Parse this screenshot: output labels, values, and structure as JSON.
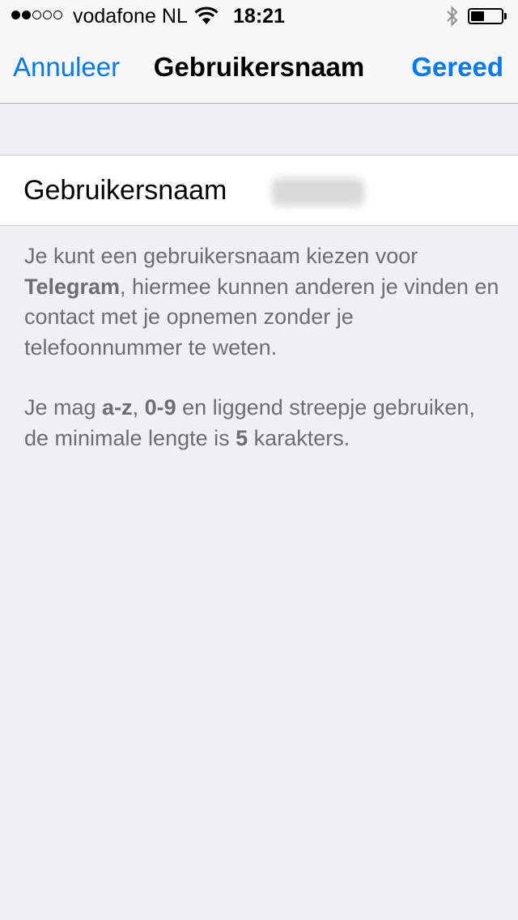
{
  "status_bar": {
    "signal_strength": "2 of 5",
    "carrier": "vodafone NL",
    "time": "18:21",
    "battery_level": 0.45,
    "icons": [
      "signal-dots-icon",
      "wifi-icon",
      "bluetooth-icon",
      "battery-icon"
    ]
  },
  "nav": {
    "cancel_label": "Annuleer",
    "title": "Gebruikersnaam",
    "done_label": "Gereed"
  },
  "field": {
    "label": "Gebruikersnaam",
    "value": "blurred"
  },
  "footer": {
    "p1_a": "Je kunt een gebruikersnaam kiezen voor ",
    "p1_b": "Telegram",
    "p1_c": ", hiermee kunnen anderen je vinden en contact met je opnemen zonder je telefoonnummer te weten.",
    "p2_a": "Je mag ",
    "p2_b": "a-z",
    "p2_c": ", ",
    "p2_d": "0-9",
    "p2_e": " en liggend streepje gebruiken, de minimale lengte is ",
    "p2_f": "5",
    "p2_g": " karakters."
  },
  "colors": {
    "accent": "#007aff",
    "background": "#efeff4",
    "footer_text": "#6d6d72"
  }
}
